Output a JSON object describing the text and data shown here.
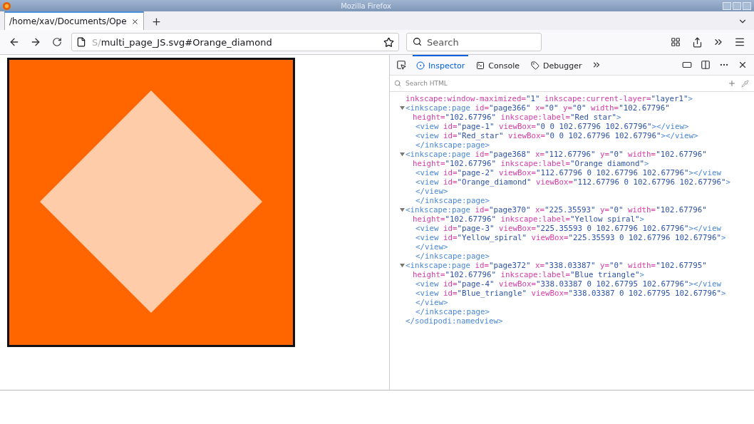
{
  "window": {
    "title": "Mozilla Firefox"
  },
  "tabs": [
    {
      "label": "/home/xav/Documents/Ope",
      "selected": true
    }
  ],
  "address_bar": {
    "faded_prefix": "S/",
    "value": "multi_page_JS.svg#Orange_diamond"
  },
  "search": {
    "placeholder": "Search"
  },
  "devtools": {
    "tabs": [
      {
        "label": "Inspector",
        "selected": true
      },
      {
        "label": "Console",
        "selected": false
      },
      {
        "label": "Debugger",
        "selected": false
      }
    ],
    "search": {
      "placeholder": "Search HTML"
    },
    "markup": [
      {
        "kind": "text",
        "tokens": [
          {
            "kind": "attr",
            "text": "inkscape:window-maximized="
          },
          {
            "kind": "value",
            "text": "\"1\""
          },
          {
            "kind": "attr",
            "text": " inkscape:current-layer="
          },
          {
            "kind": "value",
            "text": "\"layer1\""
          },
          {
            "kind": "tag",
            "text": ">"
          }
        ]
      },
      {
        "kind": "element",
        "expanded": true,
        "tokens": [
          {
            "kind": "tag",
            "text": "<inkscape:page"
          },
          {
            "kind": "attr",
            "text": " id="
          },
          {
            "kind": "value",
            "text": "\"page366\""
          },
          {
            "kind": "attr",
            "text": " x="
          },
          {
            "kind": "value",
            "text": "\"0\""
          },
          {
            "kind": "attr",
            "text": " y="
          },
          {
            "kind": "value",
            "text": "\"0\""
          },
          {
            "kind": "attr",
            "text": " width="
          },
          {
            "kind": "value",
            "text": "\"102.67796\""
          },
          {
            "kind": "attr",
            "text": " height="
          },
          {
            "kind": "value",
            "text": "\"102.67796\""
          },
          {
            "kind": "attr",
            "text": " inkscape:label="
          },
          {
            "kind": "value",
            "text": "\"Red star\""
          },
          {
            "kind": "tag",
            "text": ">"
          }
        ],
        "children": [
          {
            "kind": "text",
            "tokens": [
              {
                "kind": "tag",
                "text": "<view"
              },
              {
                "kind": "attr",
                "text": " id="
              },
              {
                "kind": "value",
                "text": "\"page-1\""
              },
              {
                "kind": "attr",
                "text": " viewBox="
              },
              {
                "kind": "value",
                "text": "\"0 0 102.67796 102.67796\""
              },
              {
                "kind": "tag",
                "text": "></view>"
              }
            ]
          },
          {
            "kind": "text",
            "tokens": [
              {
                "kind": "tag",
                "text": "<view"
              },
              {
                "kind": "attr",
                "text": " id="
              },
              {
                "kind": "value",
                "text": "\"Red_star\""
              },
              {
                "kind": "attr",
                "text": " viewBox="
              },
              {
                "kind": "value",
                "text": "\"0 0 102.67796 102.67796\""
              },
              {
                "kind": "tag",
                "text": "></view>"
              }
            ]
          }
        ],
        "closing": [
          {
            "kind": "tag",
            "text": "</inkscape:page>"
          }
        ]
      },
      {
        "kind": "element",
        "expanded": true,
        "tokens": [
          {
            "kind": "tag",
            "text": "<inkscape:page"
          },
          {
            "kind": "attr",
            "text": " id="
          },
          {
            "kind": "value",
            "text": "\"page368\""
          },
          {
            "kind": "attr",
            "text": " x="
          },
          {
            "kind": "value",
            "text": "\"112.67796\""
          },
          {
            "kind": "attr",
            "text": " y="
          },
          {
            "kind": "value",
            "text": "\"0\""
          },
          {
            "kind": "attr",
            "text": " width="
          },
          {
            "kind": "value",
            "text": "\"102.67796\""
          },
          {
            "kind": "attr",
            "text": " height="
          },
          {
            "kind": "value",
            "text": "\"102.67796\""
          },
          {
            "kind": "attr",
            "text": " inkscape:label="
          },
          {
            "kind": "value",
            "text": "\"Orange diamond\""
          },
          {
            "kind": "tag",
            "text": ">"
          }
        ],
        "children": [
          {
            "kind": "text",
            "tokens": [
              {
                "kind": "tag",
                "text": "<view"
              },
              {
                "kind": "attr",
                "text": " id="
              },
              {
                "kind": "value",
                "text": "\"page-2\""
              },
              {
                "kind": "attr",
                "text": " viewBox="
              },
              {
                "kind": "value",
                "text": "\"112.67796 0 102.67796 102.67796\""
              },
              {
                "kind": "tag",
                "text": "></view"
              }
            ]
          },
          {
            "kind": "text",
            "tokens": [
              {
                "kind": "tag",
                "text": "<view"
              },
              {
                "kind": "attr",
                "text": " id="
              },
              {
                "kind": "value",
                "text": "\"Orange_diamond\""
              },
              {
                "kind": "attr",
                "text": " viewBox="
              },
              {
                "kind": "value",
                "text": "\"112.67796 0 102.67796 102.67796\""
              },
              {
                "kind": "tag",
                "text": "></view>"
              }
            ]
          }
        ],
        "closing": [
          {
            "kind": "tag",
            "text": "</inkscape:page>"
          }
        ]
      },
      {
        "kind": "element",
        "expanded": true,
        "tokens": [
          {
            "kind": "tag",
            "text": "<inkscape:page"
          },
          {
            "kind": "attr",
            "text": " id="
          },
          {
            "kind": "value",
            "text": "\"page370\""
          },
          {
            "kind": "attr",
            "text": " x="
          },
          {
            "kind": "value",
            "text": "\"225.35593\""
          },
          {
            "kind": "attr",
            "text": " y="
          },
          {
            "kind": "value",
            "text": "\"0\""
          },
          {
            "kind": "attr",
            "text": " width="
          },
          {
            "kind": "value",
            "text": "\"102.67796\""
          },
          {
            "kind": "attr",
            "text": " height="
          },
          {
            "kind": "value",
            "text": "\"102.67796\""
          },
          {
            "kind": "attr",
            "text": " inkscape:label="
          },
          {
            "kind": "value",
            "text": "\"Yellow spiral\""
          },
          {
            "kind": "tag",
            "text": ">"
          }
        ],
        "children": [
          {
            "kind": "text",
            "tokens": [
              {
                "kind": "tag",
                "text": "<view"
              },
              {
                "kind": "attr",
                "text": " id="
              },
              {
                "kind": "value",
                "text": "\"page-3\""
              },
              {
                "kind": "attr",
                "text": " viewBox="
              },
              {
                "kind": "value",
                "text": "\"225.35593 0 102.67796 102.67796\""
              },
              {
                "kind": "tag",
                "text": "></view"
              }
            ]
          },
          {
            "kind": "text",
            "tokens": [
              {
                "kind": "tag",
                "text": "<view"
              },
              {
                "kind": "attr",
                "text": " id="
              },
              {
                "kind": "value",
                "text": "\"Yellow_spiral\""
              },
              {
                "kind": "attr",
                "text": " viewBox="
              },
              {
                "kind": "value",
                "text": "\"225.35593 0 102.67796 102.67796\""
              },
              {
                "kind": "tag",
                "text": "></view>"
              }
            ]
          }
        ],
        "closing": [
          {
            "kind": "tag",
            "text": "</inkscape:page>"
          }
        ]
      },
      {
        "kind": "element",
        "expanded": true,
        "tokens": [
          {
            "kind": "tag",
            "text": "<inkscape:page"
          },
          {
            "kind": "attr",
            "text": " id="
          },
          {
            "kind": "value",
            "text": "\"page372\""
          },
          {
            "kind": "attr",
            "text": " x="
          },
          {
            "kind": "value",
            "text": "\"338.03387\""
          },
          {
            "kind": "attr",
            "text": " y="
          },
          {
            "kind": "value",
            "text": "\"0\""
          },
          {
            "kind": "attr",
            "text": " width="
          },
          {
            "kind": "value",
            "text": "\"102.67795\""
          },
          {
            "kind": "attr",
            "text": " height="
          },
          {
            "kind": "value",
            "text": "\"102.67796\""
          },
          {
            "kind": "attr",
            "text": " inkscape:label="
          },
          {
            "kind": "value",
            "text": "\"Blue triangle\""
          },
          {
            "kind": "tag",
            "text": ">"
          }
        ],
        "children": [
          {
            "kind": "text",
            "tokens": [
              {
                "kind": "tag",
                "text": "<view"
              },
              {
                "kind": "attr",
                "text": " id="
              },
              {
                "kind": "value",
                "text": "\"page-4\""
              },
              {
                "kind": "attr",
                "text": " viewBox="
              },
              {
                "kind": "value",
                "text": "\"338.03387 0 102.67795 102.67796\""
              },
              {
                "kind": "tag",
                "text": "></view"
              }
            ]
          },
          {
            "kind": "text",
            "tokens": [
              {
                "kind": "tag",
                "text": "<view"
              },
              {
                "kind": "attr",
                "text": " id="
              },
              {
                "kind": "value",
                "text": "\"Blue_triangle\""
              },
              {
                "kind": "attr",
                "text": " viewBox="
              },
              {
                "kind": "value",
                "text": "\"338.03387 0 102.67795 102.67796\""
              },
              {
                "kind": "tag",
                "text": "></view>"
              }
            ]
          }
        ],
        "closing": [
          {
            "kind": "tag",
            "text": "</inkscape:page>"
          }
        ]
      },
      {
        "kind": "text",
        "tokens": [
          {
            "kind": "tag",
            "text": "</sodipodi:namedview>"
          }
        ]
      }
    ]
  }
}
